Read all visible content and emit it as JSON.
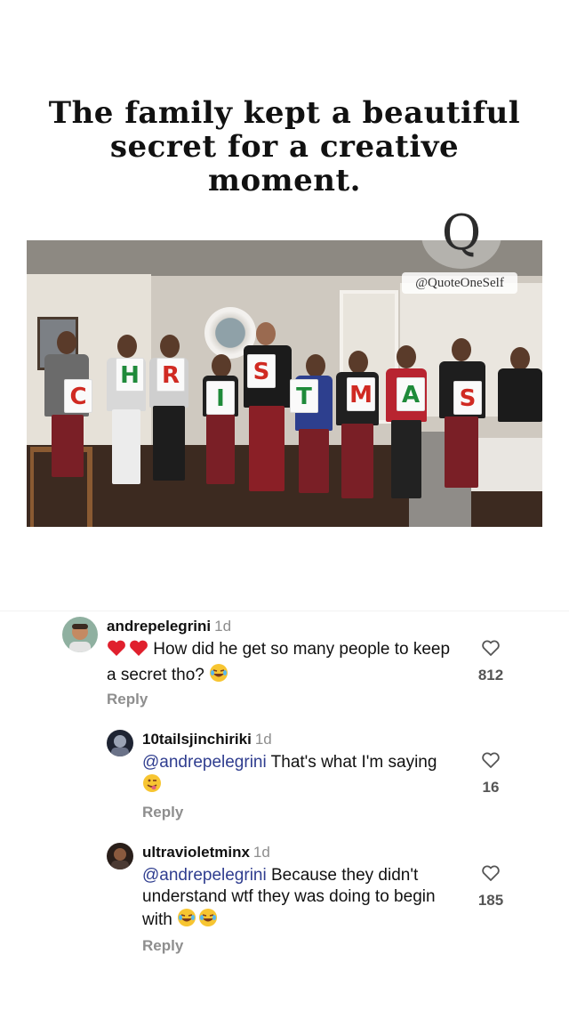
{
  "post": {
    "headline": "The family kept a beautiful secret for a creative moment.",
    "watermark": "@QuoteOneSelf",
    "watermark_logo": "Q",
    "cards": [
      {
        "letter": "C",
        "color": "#d02a22"
      },
      {
        "letter": "H",
        "color": "#1f8a3a"
      },
      {
        "letter": "R",
        "color": "#d02a22"
      },
      {
        "letter": "I",
        "color": "#1f8a3a"
      },
      {
        "letter": "S",
        "color": "#d02a22"
      },
      {
        "letter": "T",
        "color": "#1f8a3a"
      },
      {
        "letter": "M",
        "color": "#d02a22"
      },
      {
        "letter": "A",
        "color": "#1f8a3a"
      },
      {
        "letter": "S",
        "color": "#d02a22"
      }
    ]
  },
  "comments": [
    {
      "username": "andrepelegrini",
      "time": "1d",
      "prefix_emoji": [
        "red-heart-icon",
        "red-heart-icon"
      ],
      "mention": "",
      "text": "How did he get so many people to keep a secret tho?",
      "suffix_emoji": [
        "laughing-face-icon"
      ],
      "likes": "812",
      "reply_label": "Reply"
    },
    {
      "username": "10tailsjinchiriki",
      "time": "1d",
      "mention": "@andrepelegrini",
      "text": "That's what I'm saying",
      "suffix_emoji": [
        "winking-tongue-face-icon"
      ],
      "likes": "16",
      "reply_label": "Reply"
    },
    {
      "username": "ultravioletminx",
      "time": "1d",
      "mention": "@andrepelegrini",
      "text": "Because they didn't understand wtf they was doing to begin with",
      "suffix_emoji": [
        "laughing-face-icon",
        "laughing-face-icon"
      ],
      "likes": "185",
      "reply_label": "Reply"
    }
  ],
  "colors": {
    "mention": "#2f3d8f",
    "muted": "#8e8e8e",
    "heart_red": "#e0202d",
    "emoji_yellow": "#f7c531"
  }
}
